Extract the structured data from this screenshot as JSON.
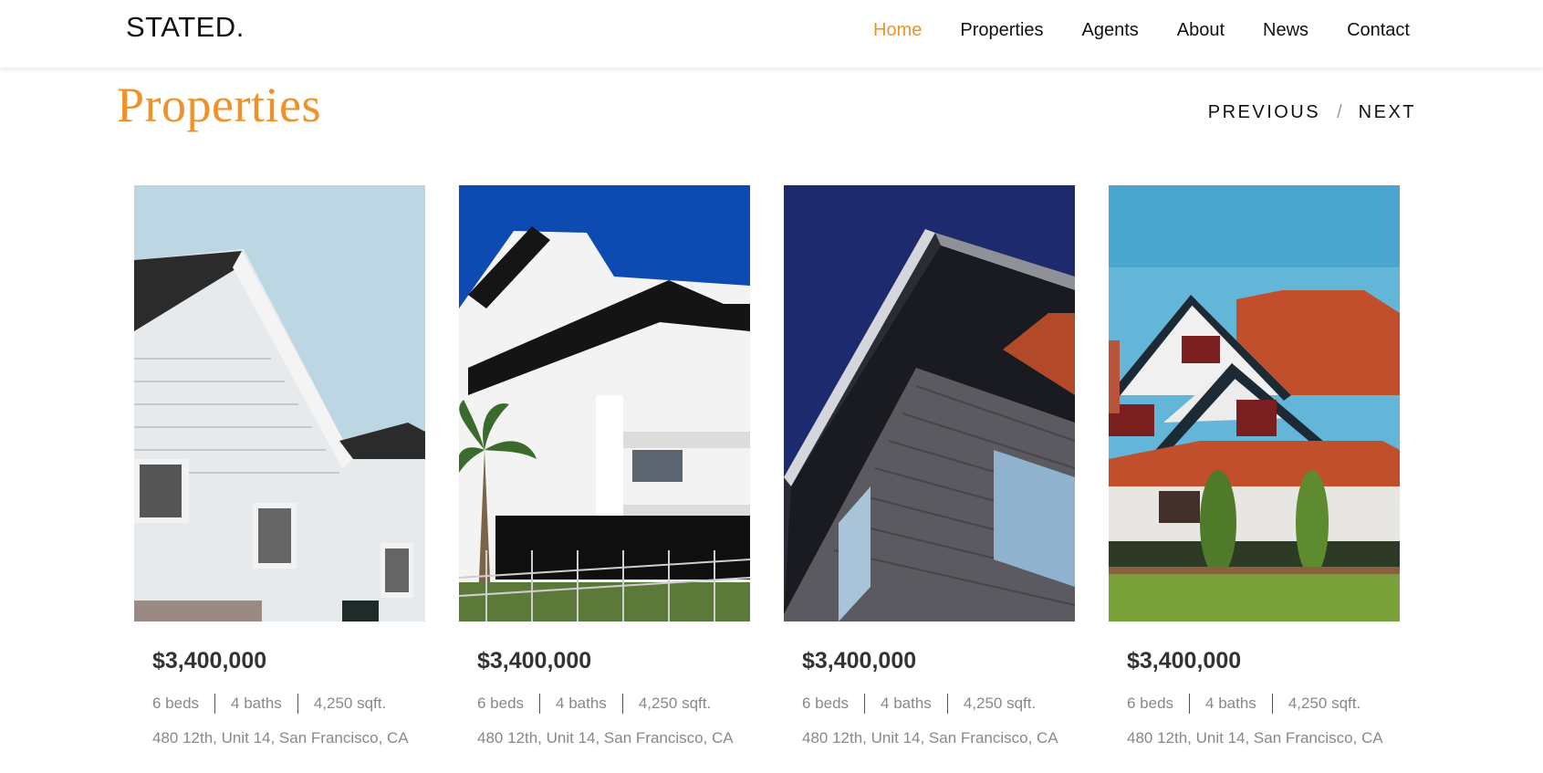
{
  "header": {
    "logo": "STATED.",
    "nav": [
      {
        "label": "Home",
        "active": true
      },
      {
        "label": "Properties",
        "active": false
      },
      {
        "label": "Agents",
        "active": false
      },
      {
        "label": "About",
        "active": false
      },
      {
        "label": "News",
        "active": false
      },
      {
        "label": "Contact",
        "active": false
      }
    ]
  },
  "section": {
    "title": "Properties",
    "previous": "PREVIOUS",
    "separator": "/",
    "next": "NEXT"
  },
  "colors": {
    "accent": "#f0922b",
    "text": "#111111",
    "muted": "#888888"
  },
  "properties": [
    {
      "image": "white-gabled-house-photo",
      "price": "$3,400,000",
      "beds": "6 beds",
      "baths": "4 baths",
      "area": "4,250 sqft.",
      "address": "480 12th, Unit 14, San Francisco, CA"
    },
    {
      "image": "modern-white-apartment-photo",
      "price": "$3,400,000",
      "beds": "6 beds",
      "baths": "4 baths",
      "area": "4,250 sqft.",
      "address": "480 12th, Unit 14, San Francisco, CA"
    },
    {
      "image": "brick-building-corner-photo",
      "price": "$3,400,000",
      "beds": "6 beds",
      "baths": "4 baths",
      "area": "4,250 sqft.",
      "address": "480 12th, Unit 14, San Francisco, CA"
    },
    {
      "image": "tudor-house-photo",
      "price": "$3,400,000",
      "beds": "6 beds",
      "baths": "4 baths",
      "area": "4,250 sqft.",
      "address": "480 12th, Unit 14, San Francisco, CA"
    }
  ]
}
